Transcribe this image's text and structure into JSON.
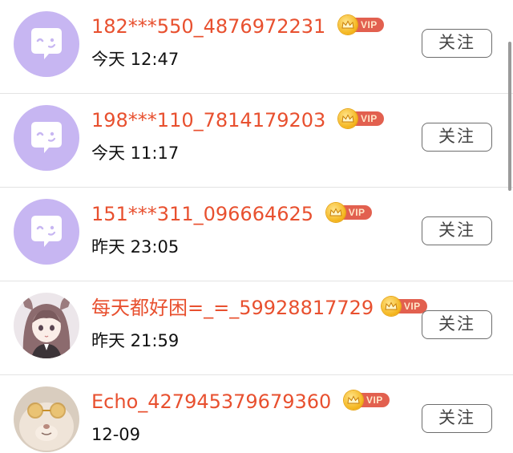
{
  "users": [
    {
      "name": "182***550_4876972231",
      "vip": "VIP",
      "time": "今天 12:47",
      "follow": "关注",
      "avatar": "default-chat-avatar-icon"
    },
    {
      "name": "198***110_7814179203",
      "vip": "VIP",
      "time": "今天 11:17",
      "follow": "关注",
      "avatar": "default-chat-avatar-icon"
    },
    {
      "name": "151***311_096664625",
      "vip": "VIP",
      "time": "昨天 23:05",
      "follow": "关注",
      "avatar": "default-chat-avatar-icon"
    },
    {
      "name": "每天都好困=_=_59928817729",
      "vip": "VIP",
      "time": "昨天 21:59",
      "follow": "关注",
      "avatar": "anime-girl-avatar"
    },
    {
      "name": "Echo_427945379679360",
      "vip": "VIP",
      "time": "12-09",
      "follow": "关注",
      "avatar": "cat-with-sunglasses-avatar"
    }
  ],
  "colors": {
    "name": "#e8502f",
    "avatar_default_bg": "#c7b6f2",
    "vip_tag": "#e2604f",
    "divider": "#e3e3e3"
  }
}
